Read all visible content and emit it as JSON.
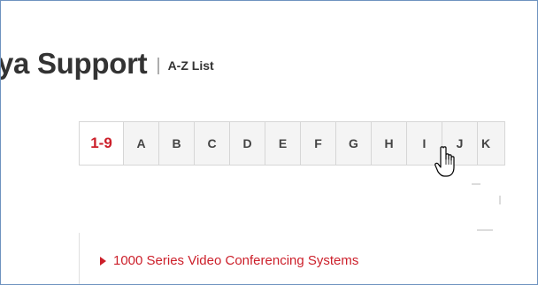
{
  "header": {
    "title": "ya Support",
    "separator": "|",
    "subtitle": "A-Z List"
  },
  "az_tabs": {
    "active": "1-9",
    "items": [
      "1-9",
      "A",
      "B",
      "C",
      "D",
      "E",
      "F",
      "G",
      "H",
      "I",
      "J",
      "K"
    ]
  },
  "list": {
    "items": [
      {
        "label": "1000 Series Video Conferencing Systems"
      }
    ]
  },
  "colors": {
    "accent": "#cc1f2a",
    "tab_background": "#f4f4f4",
    "border": "#6f93c0"
  },
  "icons": {
    "cursor": "hand-pointer-icon",
    "bullet": "triangle-right-icon"
  }
}
